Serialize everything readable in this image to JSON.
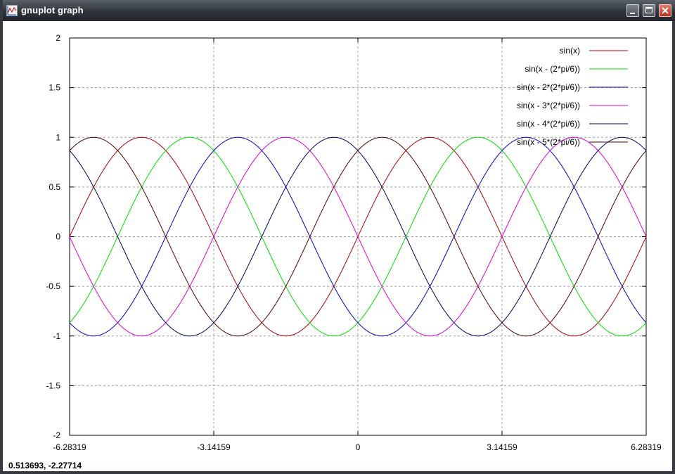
{
  "window": {
    "title": "gnuplot graph",
    "icon": "gnuplot-graph-icon",
    "controls": {
      "minimize": "minimize-icon",
      "maximize": "maximize-icon",
      "close": "close-icon"
    }
  },
  "status": {
    "coordinates": "0.513693, -2.27714"
  },
  "colors": {
    "background": "#ffffff",
    "grid": "#a0a0a0",
    "border": "#000000"
  },
  "chart_data": {
    "type": "line",
    "title": "",
    "xlabel": "",
    "ylabel": "",
    "xlim": [
      -6.28319,
      6.28319
    ],
    "ylim": [
      -2,
      2
    ],
    "grid": true,
    "legend_position": "top-right",
    "x_ticks": [
      {
        "value": -6.28319,
        "label": "-6.28319"
      },
      {
        "value": -3.14159,
        "label": "-3.14159"
      },
      {
        "value": 0,
        "label": "0"
      },
      {
        "value": 3.14159,
        "label": "3.14159"
      },
      {
        "value": 6.28319,
        "label": "6.28319"
      }
    ],
    "y_ticks": [
      {
        "value": 2,
        "label": "2"
      },
      {
        "value": 1.5,
        "label": "1.5"
      },
      {
        "value": 1,
        "label": "1"
      },
      {
        "value": 0.5,
        "label": "0.5"
      },
      {
        "value": 0,
        "label": "0"
      },
      {
        "value": -0.5,
        "label": "-0.5"
      },
      {
        "value": -1,
        "label": "-1"
      },
      {
        "value": -1.5,
        "label": "-1.5"
      },
      {
        "value": -2,
        "label": "-2"
      }
    ],
    "series": [
      {
        "name": "sin(x)",
        "phase": 0,
        "color": "#b00000"
      },
      {
        "name": "sin(x - (2*pi/6))",
        "phase": 1.0471976,
        "color": "#00e000"
      },
      {
        "name": "sin(x - 2*(2*pi/6))",
        "phase": 2.0943951,
        "color": "#0000c0"
      },
      {
        "name": "sin(x - 3*(2*pi/6))",
        "phase": 3.1415927,
        "color": "#e000e0"
      },
      {
        "name": "sin(x - 4*(2*pi/6))",
        "phase": 4.1887902,
        "color": "#000060"
      },
      {
        "name": "sin(x - 5*(2*pi/6))",
        "phase": 5.2359878,
        "color": "#500000"
      }
    ]
  }
}
